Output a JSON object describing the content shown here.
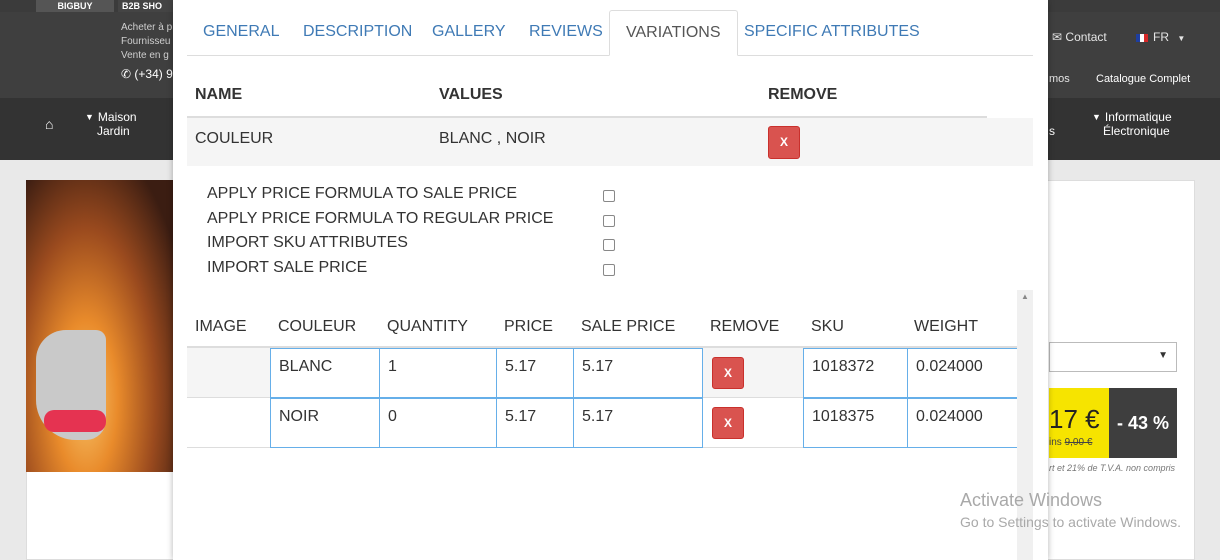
{
  "background": {
    "topbar": {
      "tab1": "BIGBUY",
      "tab2": "B2B SHO"
    },
    "header": {
      "line1": "Acheter à p",
      "line2": "Fournisseu",
      "line3": "Vente en g",
      "phone": "(+34) 9",
      "contact": "Contact",
      "lang": "FR",
      "subnav_a": "mos",
      "subnav_b": "Catalogue Complet"
    },
    "nav": {
      "cat1_line1": "Maison",
      "cat1_line2": "Jardin",
      "cat_partial": "s",
      "cat_last_line1": "Informatique",
      "cat_last_line2": "Électronique"
    },
    "product": {
      "price": "17 €",
      "old_price_prefix": "ins",
      "old_price": "9,00 €",
      "discount": "- 43 %",
      "tax_note": "rt et 21% de T.V.A. non compris"
    },
    "watermark": {
      "line1": "Activate Windows",
      "line2": "Go to Settings to activate Windows."
    }
  },
  "modal": {
    "tabs": [
      {
        "label": "GENERAL"
      },
      {
        "label": "DESCRIPTION"
      },
      {
        "label": "GALLERY"
      },
      {
        "label": "REVIEWS"
      },
      {
        "label": "VARIATIONS",
        "active": true
      },
      {
        "label": "SPECIFIC ATTRIBUTES"
      }
    ],
    "attributes": {
      "headers": {
        "name": "NAME",
        "values": "VALUES",
        "remove": "REMOVE"
      },
      "rows": [
        {
          "name": "COULEUR",
          "values": "BLANC , NOIR",
          "remove_label": "X"
        }
      ]
    },
    "options": [
      {
        "label": "APPLY PRICE FORMULA TO SALE PRICE",
        "checked": false
      },
      {
        "label": "APPLY PRICE FORMULA TO REGULAR PRICE",
        "checked": false
      },
      {
        "label": "IMPORT SKU ATTRIBUTES",
        "checked": false
      },
      {
        "label": "IMPORT SALE PRICE",
        "checked": false
      }
    ],
    "variations": {
      "headers": {
        "image": "IMAGE",
        "couleur": "COULEUR",
        "quantity": "QUANTITY",
        "price": "PRICE",
        "sale_price": "SALE PRICE",
        "remove": "REMOVE",
        "sku": "SKU",
        "weight": "WEIGHT"
      },
      "rows": [
        {
          "couleur": "BLANC",
          "quantity": "1",
          "price": "5.17",
          "sale_price": "5.17",
          "remove_label": "X",
          "sku": "1018372",
          "weight": "0.024000"
        },
        {
          "couleur": "NOIR",
          "quantity": "0",
          "price": "5.17",
          "sale_price": "5.17",
          "remove_label": "X",
          "sku": "1018375",
          "weight": "0.024000"
        }
      ]
    }
  }
}
